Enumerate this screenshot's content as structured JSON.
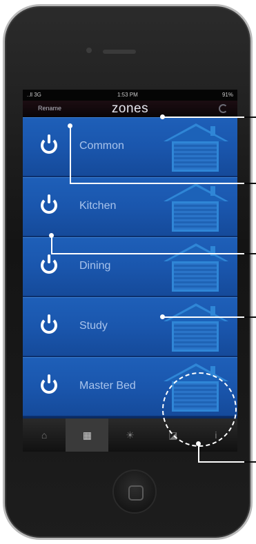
{
  "status_bar": {
    "signal": "..ll 3G",
    "time": "1:53 PM",
    "battery": "91%"
  },
  "nav": {
    "left_label": "Rename",
    "title": "zones",
    "right_icon": "refresh-icon"
  },
  "zones": [
    {
      "label": "Common",
      "icon": "power-icon"
    },
    {
      "label": "Kitchen",
      "icon": "power-icon"
    },
    {
      "label": "Dining",
      "icon": "power-icon"
    },
    {
      "label": "Study",
      "icon": "power-icon"
    },
    {
      "label": "Master Bed",
      "icon": "power-icon"
    }
  ],
  "tabs": [
    {
      "icon": "home-icon",
      "glyph": "⌂"
    },
    {
      "icon": "zones-icon",
      "glyph": "▦",
      "active": true
    },
    {
      "icon": "lighting-icon",
      "glyph": "☀"
    },
    {
      "icon": "settings-icon",
      "glyph": "◪"
    },
    {
      "icon": "info-icon",
      "glyph": "i"
    }
  ],
  "colors": {
    "zone_row": "#1a56ad",
    "nav_bar": "#1c0d12",
    "accent_house": "#2f86d6",
    "callout": "#ffffff"
  }
}
